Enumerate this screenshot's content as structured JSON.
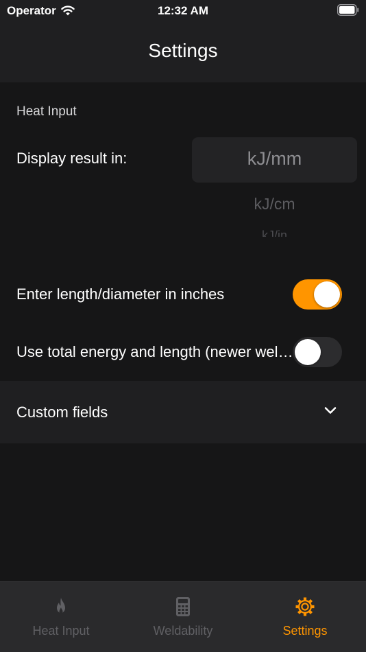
{
  "status_bar": {
    "carrier": "Operator",
    "time": "12:32 AM"
  },
  "nav": {
    "title": "Settings"
  },
  "heat_input": {
    "section_title": "Heat Input",
    "display_label": "Display result in:",
    "unit_options": [
      "kJ/mm",
      "kJ/cm",
      "kJ/in"
    ],
    "selected_unit": "kJ/mm"
  },
  "toggles": {
    "inches": {
      "label": "Enter length/diameter in inches",
      "value": true
    },
    "total_energy": {
      "label": "Use total energy and length (newer welding standards)",
      "value": false
    }
  },
  "custom_fields": {
    "label": "Custom fields"
  },
  "tabbar": {
    "tabs": [
      {
        "label": "Heat Input",
        "icon": "flame-icon"
      },
      {
        "label": "Weldability",
        "icon": "calculator-icon"
      },
      {
        "label": "Settings",
        "icon": "gear-icon"
      }
    ],
    "active_index": 2
  },
  "colors": {
    "accent": "#ff9500",
    "background": "#161617",
    "surface": "#1f1f21"
  }
}
